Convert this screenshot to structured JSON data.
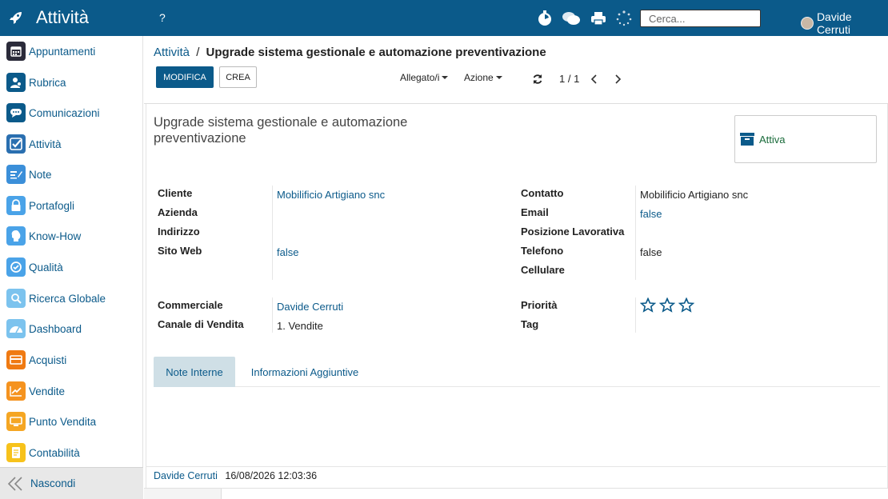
{
  "topbar": {
    "app_title": "Attività",
    "help": "?",
    "search_placeholder": "Cerca...",
    "user_name": "Davide Cerruti"
  },
  "sidebar": {
    "items": [
      {
        "label": "Appuntamenti",
        "icon": "calendar-icon",
        "color": "#2b2b3a"
      },
      {
        "label": "Rubrica",
        "icon": "contacts-icon",
        "color": "#0b5a8a"
      },
      {
        "label": "Comunicazioni",
        "icon": "chat-icon",
        "color": "#0b5a8a"
      },
      {
        "label": "Attività",
        "icon": "check-icon",
        "color": "#2a6fb0"
      },
      {
        "label": "Note",
        "icon": "note-icon",
        "color": "#3b8fd9"
      },
      {
        "label": "Portafogli",
        "icon": "lock-icon",
        "color": "#4aa3e8"
      },
      {
        "label": "Know-How",
        "icon": "brain-icon",
        "color": "#4aa3e8"
      },
      {
        "label": "Qualità",
        "icon": "quality-icon",
        "color": "#4aa3e8"
      },
      {
        "label": "Ricerca Globale",
        "icon": "search-icon",
        "color": "#7cc3ee"
      },
      {
        "label": "Dashboard",
        "icon": "dashboard-icon",
        "color": "#7cc3ee"
      },
      {
        "label": "Acquisti",
        "icon": "card-icon",
        "color": "#f07a12"
      },
      {
        "label": "Vendite",
        "icon": "chart-icon",
        "color": "#f5931f"
      },
      {
        "label": "Punto Vendita",
        "icon": "pos-icon",
        "color": "#f5a623"
      },
      {
        "label": "Contabilità",
        "icon": "ledger-icon",
        "color": "#f7c21b"
      }
    ],
    "footer_label": "Nascondi"
  },
  "breadcrumb": {
    "parent": "Attività",
    "separator": "/",
    "current": "Upgrade sistema gestionale e automazione preventivazione"
  },
  "toolbar": {
    "edit_label": "MODIFICA",
    "create_label": "CREA",
    "attachments_label": "Allegato/i",
    "action_label": "Azione",
    "pager": "1 / 1"
  },
  "record": {
    "title": "Upgrade sistema gestionale e automazione preventivazione",
    "status": "Attiva",
    "left_fields": [
      {
        "label": "Cliente",
        "value": "Mobilificio Artigiano snc"
      },
      {
        "label": "Azienda",
        "value": ""
      },
      {
        "label": "Indirizzo",
        "value": ""
      },
      {
        "label": "Sito Web",
        "value": "false"
      }
    ],
    "right_fields": [
      {
        "label": "Contatto",
        "value": "Mobilificio Artigiano snc"
      },
      {
        "label": "Email",
        "value": "false"
      },
      {
        "label": "Posizione Lavorativa",
        "value": ""
      },
      {
        "label": "Telefono",
        "value": "false"
      },
      {
        "label": "Cellulare",
        "value": ""
      }
    ],
    "left_fields2": [
      {
        "label": "Commerciale",
        "value": "Davide Cerruti"
      },
      {
        "label": "Canale di Vendita",
        "value": "1. Vendite"
      }
    ],
    "right_fields2": [
      {
        "label": "Priorità",
        "value": ""
      },
      {
        "label": "Tag",
        "value": ""
      }
    ],
    "priority_stars": 0,
    "priority_max": 3
  },
  "tabs": [
    {
      "label": "Note Interne",
      "active": true
    },
    {
      "label": "Informazioni Aggiuntive",
      "active": false
    }
  ],
  "chatter": {
    "author": "Davide Cerruti",
    "date": "16/08/2026 12:03:36"
  }
}
